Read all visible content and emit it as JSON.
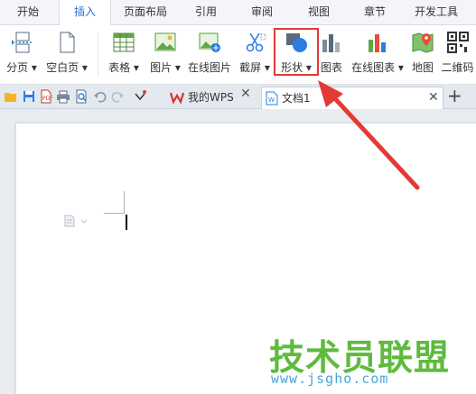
{
  "menu": {
    "tabs": [
      "开始",
      "插入",
      "页面布局",
      "引用",
      "审阅",
      "视图",
      "章节",
      "开发工具"
    ],
    "active": "插入"
  },
  "ribbon": {
    "buttons": [
      {
        "label": "分页",
        "dropdown": true,
        "icon": "page-break-icon"
      },
      {
        "label": "空白页",
        "dropdown": true,
        "icon": "blank-page-icon"
      },
      {
        "label": "表格",
        "dropdown": true,
        "icon": "table-icon"
      },
      {
        "label": "图片",
        "dropdown": true,
        "icon": "picture-icon"
      },
      {
        "label": "在线图片",
        "dropdown": false,
        "icon": "online-picture-icon"
      },
      {
        "label": "截屏",
        "dropdown": true,
        "icon": "screenshot-icon"
      },
      {
        "label": "形状",
        "dropdown": true,
        "icon": "shapes-icon"
      },
      {
        "label": "图表",
        "dropdown": false,
        "icon": "chart-icon"
      },
      {
        "label": "在线图表",
        "dropdown": true,
        "icon": "online-chart-icon"
      },
      {
        "label": "地图",
        "dropdown": false,
        "icon": "map-icon"
      },
      {
        "label": "二维码",
        "dropdown": false,
        "icon": "qrcode-icon"
      }
    ]
  },
  "doc_tabs": {
    "wps": "我的WPS",
    "doc": "文档1",
    "add": "+"
  },
  "watermark": {
    "brand": "技术员联盟",
    "url": "www.jsgho.com"
  },
  "colors": {
    "accent": "#1f6fd1",
    "highlight": "#e43a36",
    "watermark_green": "#5fba3e",
    "watermark_blue": "#4aa5d8"
  }
}
